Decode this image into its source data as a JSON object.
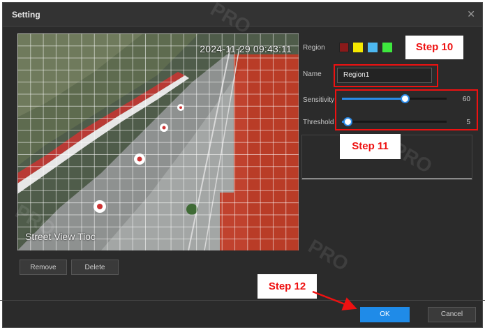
{
  "dialog": {
    "title": "Setting",
    "close_icon": "close-icon"
  },
  "video": {
    "timestamp": "2024-11-29 09:43:11",
    "camera_name": "Street View Tioc"
  },
  "actions": {
    "remove_label": "Remove",
    "delete_label": "Delete",
    "ok_label": "OK",
    "cancel_label": "Cancel"
  },
  "region": {
    "label": "Region",
    "colors": [
      "#8b1a1a",
      "#f5e800",
      "#4db8f0",
      "#3ee83e"
    ]
  },
  "name": {
    "label": "Name",
    "value": "Region1"
  },
  "sensitivity": {
    "label": "Sensitivity",
    "value": "60",
    "level": 0.6
  },
  "threshold": {
    "label": "Threshold",
    "value": "5",
    "level": 0.05
  },
  "annotations": {
    "step10": "Step 10",
    "step11": "Step 11",
    "step12": "Step 12",
    "accent_color": "#ee1111"
  }
}
